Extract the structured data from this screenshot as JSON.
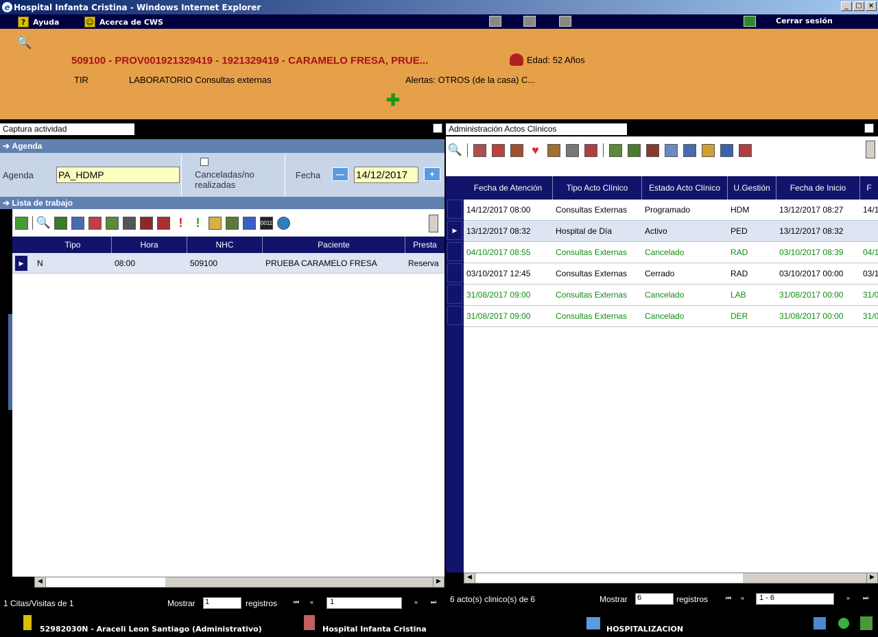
{
  "window": {
    "title": "Hospital Infanta Cristina - Windows Internet Explorer"
  },
  "menu": {
    "ayuda": "Ayuda",
    "acerca": "Acerca de CWS",
    "logout": "Cerrar sesión"
  },
  "patient": {
    "line1": "509100 - PROV001921329419 - 1921329419 - CARAMELO FRESA, PRUE...",
    "age": "Edad: 52 Años",
    "tir": "TIR",
    "service": "LABORATORIO Consultas externas",
    "alerts": "Alertas: OTROS (de la casa) C..."
  },
  "left": {
    "section": "Captura actividad",
    "agenda_bar": "Agenda",
    "agenda_label": "Agenda",
    "agenda_value": "PA_HDMP",
    "canceladas": "Canceladas/no realizadas",
    "fecha_label": "Fecha",
    "fecha_value": "14/12/2017",
    "worklist_bar": "Lista de trabajo",
    "columns": [
      "Tipo",
      "Hora",
      "NHC",
      "Paciente",
      "Presta"
    ],
    "rows": [
      [
        "N",
        "08:00",
        "509100",
        "PRUEBA CARAMELO FRESA",
        "Reserva"
      ]
    ],
    "footer_count": "1 Citas/Visitas de 1",
    "mostrar": "Mostrar",
    "mostrar_value": "1",
    "registros": "registros",
    "page_value": "1"
  },
  "right": {
    "section": "Administración Actos Clínicos",
    "columns": [
      "Fecha de Atención",
      "Tipo Acto Clínico",
      "Estado Acto Clínico",
      "U.Gestión",
      "Fecha de Inicio",
      "F"
    ],
    "rows": [
      [
        "14/12/2017 08:00",
        "Consultas Externas",
        "Programado",
        "HDM",
        "13/12/2017 08:27",
        "14/1"
      ],
      [
        "13/12/2017 08:32",
        "Hospital de Día",
        "Activo",
        "PED",
        "13/12/2017 08:32",
        ""
      ],
      [
        "04/10/2017 08:55",
        "Consultas Externas",
        "Cancelado",
        "RAD",
        "03/10/2017 08:39",
        "04/1"
      ],
      [
        "03/10/2017 12:45",
        "Consultas Externas",
        "Cerrado",
        "RAD",
        "03/10/2017 00:00",
        "03/1"
      ],
      [
        "31/08/2017 09:00",
        "Consultas Externas",
        "Cancelado",
        "LAB",
        "31/08/2017 00:00",
        "31/0"
      ],
      [
        "31/08/2017 09:00",
        "Consultas Externas",
        "Cancelado",
        "DER",
        "31/08/2017 00:00",
        "31/0"
      ]
    ],
    "footer_count": "6 acto(s) clinico(s) de 6",
    "mostrar": "Mostrar",
    "mostrar_value": "6",
    "registros": "registros",
    "page_value": "1 - 6"
  },
  "status": {
    "user": "52982030N - Araceli Leon Santiago (Administrativo)",
    "hospital": "Hospital Infanta Cristina",
    "unit": "HOSPITALIZACION"
  }
}
